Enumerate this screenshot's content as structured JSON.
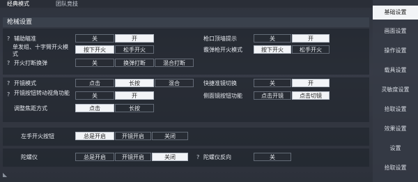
{
  "tabs": [
    "经典模式",
    "团队竞技"
  ],
  "section_title": "枪械设置",
  "rows": {
    "r1": {
      "label": "辅助瞄准",
      "opts": [
        "关",
        "开"
      ]
    },
    "r1b": {
      "label": "枪口顶墙提示",
      "opts": [
        "关",
        "开"
      ]
    },
    "r2": {
      "label": "单发组、十字臂开火模式",
      "opts": [
        "按下开火",
        "松手开火"
      ]
    },
    "r2b": {
      "label": "霰弹枪开火模式",
      "opts": [
        "按下开火",
        "松手开火"
      ]
    },
    "r3": {
      "label": "开火打断换弹",
      "opts": [
        "关",
        "换弹打断",
        "混合打断"
      ]
    },
    "r4": {
      "label": "开镜模式",
      "opts": [
        "点击",
        "长按",
        "混合"
      ]
    },
    "r4b": {
      "label": "快捷准镜切换",
      "opts": [
        "关",
        "开"
      ]
    },
    "r5": {
      "label": "开镜按钮转动视角功能",
      "opts": [
        "关",
        "开"
      ]
    },
    "r5b": {
      "label": "侧面镜按钮功能",
      "opts": [
        "点击开镜",
        "点击切镜"
      ]
    },
    "r6": {
      "label": "调整焦距方式",
      "opts": [
        "点击",
        "长按"
      ]
    },
    "r7": {
      "label": "左手开火按钮",
      "opts": [
        "总是开启",
        "开镜开启",
        "关闭"
      ]
    },
    "r8": {
      "label": "陀螺仪",
      "opts": [
        "总是开启",
        "开镜开启",
        "关闭"
      ]
    },
    "r8b": {
      "label": "陀螺仪反向",
      "opts": [
        "关"
      ]
    }
  },
  "sidebar": [
    "基础设置",
    "画面设置",
    "操作设置",
    "载具设置",
    "灵敏度设置",
    "拾取设置",
    "效果设置",
    "设置",
    "拾取设置"
  ],
  "colors": {
    "selected": "#f2f4f7",
    "unselected": "#282c34"
  }
}
